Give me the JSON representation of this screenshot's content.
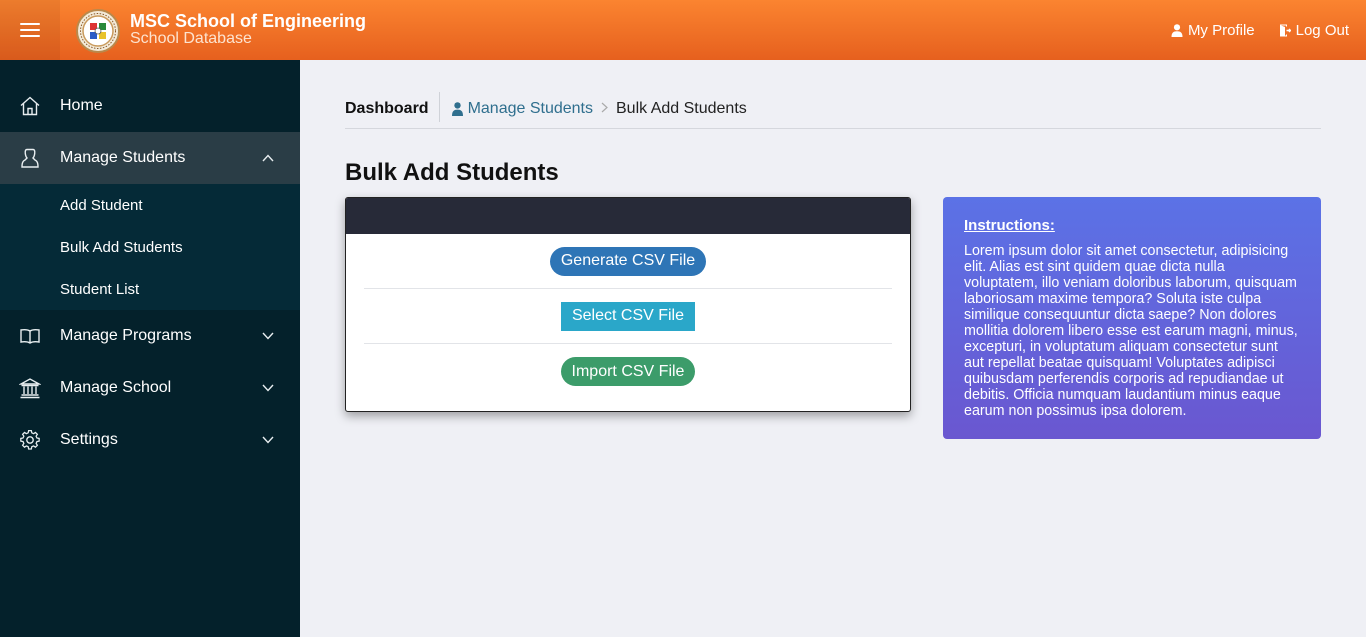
{
  "header": {
    "school_name": "MSC School of Engineering",
    "subtitle": "School Database",
    "links": {
      "profile": "My Profile",
      "logout": "Log Out"
    },
    "accent": "#f47a2a"
  },
  "sidebar": {
    "items": [
      {
        "label": "Home",
        "icon": "home-icon"
      },
      {
        "label": "Manage Students",
        "icon": "user-icon",
        "expanded": true,
        "children": [
          "Add Student",
          "Bulk Add Students",
          "Student List"
        ]
      },
      {
        "label": "Manage Programs",
        "icon": "book-icon"
      },
      {
        "label": "Manage School",
        "icon": "bank-icon"
      },
      {
        "label": "Settings",
        "icon": "gear-icon"
      }
    ]
  },
  "breadcrumb": {
    "dashboard": "Dashboard",
    "section": "Manage Students",
    "current": "Bulk Add Students"
  },
  "page": {
    "title": "Bulk Add Students",
    "buttons": {
      "generate": "Generate CSV File",
      "select": "Select CSV File",
      "import": "Import CSV File"
    },
    "instructions": {
      "title": "Instructions:",
      "text": "Lorem ipsum dolor sit amet consectetur, adipisicing elit. Alias est sint quidem quae dicta nulla voluptatem, illo veniam doloribus laborum, quisquam laboriosam maxime tempora? Soluta iste culpa similique consequuntur dicta saepe? Non dolores mollitia dolorem libero esse est earum magni, minus, excepturi, in voluptatum aliquam consectetur sunt aut repellat beatae quisquam! Voluptates adipisci quibusdam perferendis corporis ad repudiandae ut debitis. Officia numquam laudantium minus eaque earum non possimus ipsa dolorem."
    }
  }
}
